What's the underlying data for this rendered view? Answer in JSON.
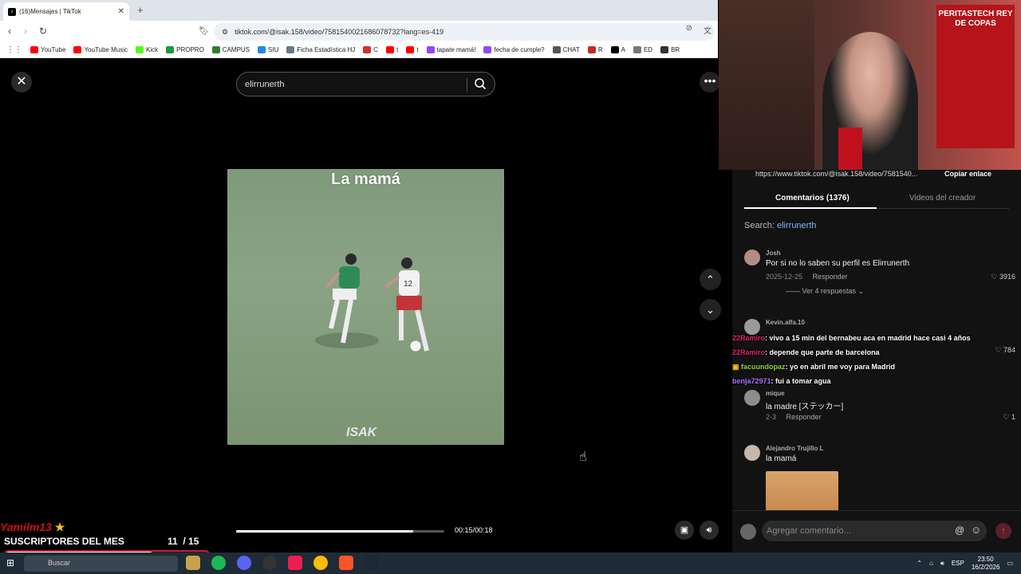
{
  "browser": {
    "tab_title": "(16)Mensajes | TikTok",
    "url": "tiktok.com/@isak.158/video/7581540021686078732?lang=es-419",
    "bookmarks": [
      {
        "label": "YouTube",
        "color": "#ff0000"
      },
      {
        "label": "YouTube Music",
        "color": "#ff0000"
      },
      {
        "label": "Kick",
        "color": "#53fc18"
      },
      {
        "label": "PROPRO",
        "color": "#1a9a3a"
      },
      {
        "label": "CAMPUS",
        "color": "#2e7d32"
      },
      {
        "label": "SIU",
        "color": "#1e88e5"
      },
      {
        "label": "Ficha Estadística HJ",
        "color": "#607d8b"
      },
      {
        "label": "C",
        "color": "#d32f2f"
      },
      {
        "label": "t",
        "color": "#ff0000"
      },
      {
        "label": "t",
        "color": "#ff0000"
      },
      {
        "label": "tapate mamá!",
        "color": "#9146ff"
      },
      {
        "label": "fecha de cumple?",
        "color": "#9146ff"
      },
      {
        "label": "CHAT",
        "color": "#555555"
      },
      {
        "label": "R",
        "color": "#c62828"
      },
      {
        "label": "A",
        "color": "#000000"
      },
      {
        "label": "ED",
        "color": "#777777"
      },
      {
        "label": "BR",
        "color": "#333333"
      }
    ]
  },
  "video": {
    "search_value": "elirrunerth",
    "overlay_title": "La mamá",
    "watermark": "ISAK",
    "time": "00:15/00:18",
    "progress": 0.85
  },
  "panel": {
    "link": "https://www.tiktok.com/@isak.158/video/7581540...",
    "copy_link": "Copiar enlace",
    "tabs": [
      "Comentarios (1376)",
      "Videos del creador"
    ],
    "search_label": "Search:",
    "search_term": "elirrunerth",
    "comments": [
      {
        "user": "Josh",
        "text": "Por si no lo saben su perfil es Elirrunerth",
        "date": "2025-12-25",
        "reply": "Responder",
        "likes": "3916",
        "replies": "Ver 4 respuestas"
      },
      {
        "user": "Kevin.alfa.10",
        "text": "",
        "date": "",
        "reply": "Responder",
        "likes": "784"
      },
      {
        "user": "mique",
        "text": "la madre [ステッカー]",
        "date": "2-3",
        "reply": "Responder",
        "likes": "1"
      },
      {
        "user": "Alejandro Trujillo L",
        "text": "la mamá",
        "date": "",
        "reply": "",
        "likes": ""
      }
    ],
    "comment_placeholder": "Agregar comentario..."
  },
  "chat": [
    {
      "user": "22Ramiro",
      "color": "#e0226b",
      "msg": ": vivo a 15 min del bernabeu aca en madrid hace casi 4 años"
    },
    {
      "user": "22Ramiro",
      "color": "#e0226b",
      "msg": ": depende que parte de barcelona"
    },
    {
      "user": "facuundopaz",
      "color": "#8bd93d",
      "msg": ": yo en abril me voy para Madrid"
    },
    {
      "user": "benja72971",
      "color": "#a970ff",
      "msg": ": fui a tomar agua"
    }
  ],
  "stream": {
    "sub_name": "Yamilm13",
    "sub_title": "SUSCRIPTORES DEL MES",
    "sub_count": "11",
    "sub_total": "/ 15",
    "sub_progress": 0.73
  },
  "webcam": {
    "poster_text": "PERITASTECH REY DE COPAS"
  },
  "taskbar": {
    "search_label": "Buscar",
    "lang": "ESP",
    "time": "23:50",
    "date": "16/2/2026"
  }
}
